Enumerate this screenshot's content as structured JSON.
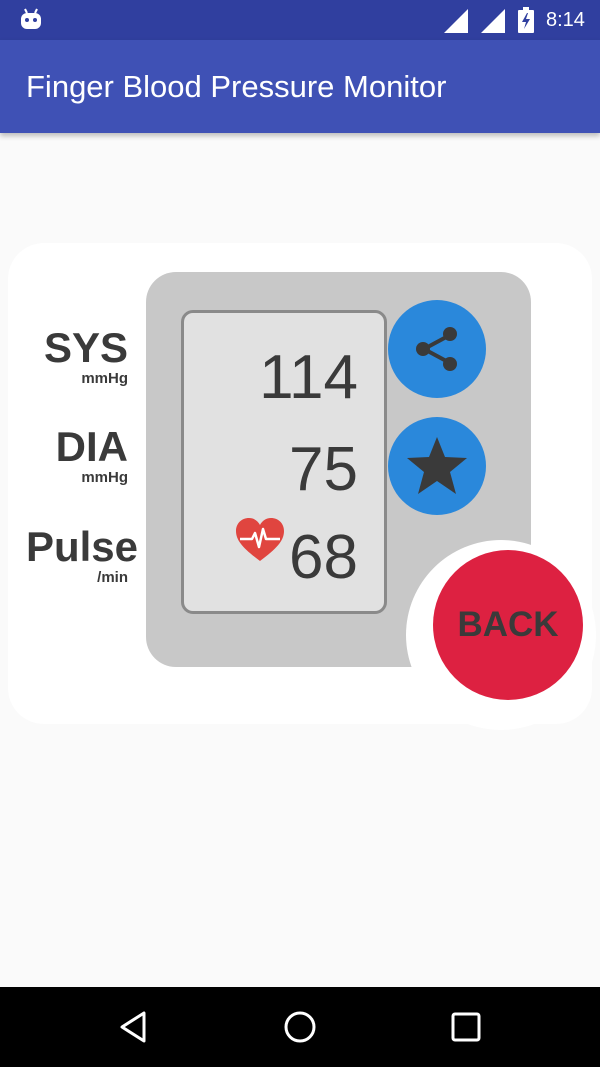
{
  "status_bar": {
    "time": "8:14",
    "icons": [
      "android-notification-icon",
      "cell-signal-icon",
      "wifi-signal-icon",
      "battery-charging-icon"
    ]
  },
  "app_bar": {
    "title": "Finger Blood Pressure Monitor"
  },
  "monitor": {
    "labels": {
      "sys": "SYS",
      "sys_unit": "mmHg",
      "dia": "DIA",
      "dia_unit": "mmHg",
      "pulse": "Pulse",
      "pulse_unit": "/min"
    },
    "readings": {
      "sys": "114",
      "dia": "75",
      "pulse": "68"
    },
    "icons": {
      "heart": "heart-pulse-icon",
      "share": "share-icon",
      "rate": "star-icon"
    }
  },
  "back_button": {
    "label": "BACK"
  },
  "nav_bar": {
    "icons": [
      "back-triangle-icon",
      "home-circle-icon",
      "recents-square-icon"
    ]
  },
  "colors": {
    "status_bar": "#303f9f",
    "app_bar": "#3f51b5",
    "background": "#fafafa",
    "device_body": "#c8c8c8",
    "screen": "#e1e1e1",
    "action_blue": "#2a88db",
    "back_red": "#dd2141",
    "heart_red": "#e0453f"
  }
}
